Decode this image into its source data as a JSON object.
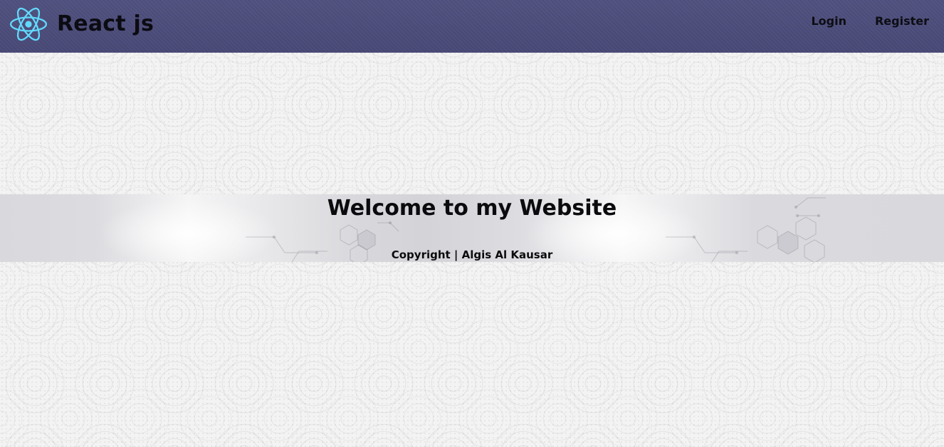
{
  "navbar": {
    "brand_label": "React js",
    "logo_icon": "react-logo-icon",
    "links": [
      {
        "label": "Login"
      },
      {
        "label": "Register"
      }
    ],
    "background_color": "#4a4a7a",
    "logo_color": "#61dafb"
  },
  "hero": {
    "title": "Welcome to my Website",
    "copyright": "Copyright | Algis Al Kausar"
  }
}
